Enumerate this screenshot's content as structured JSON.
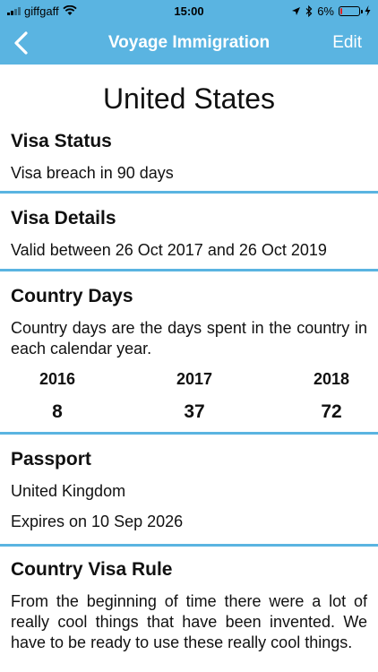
{
  "status_bar": {
    "carrier": "giffgaff",
    "time": "15:00",
    "battery_percent": "6%",
    "battery_level": 0.06
  },
  "nav": {
    "title": "Voyage Immigration",
    "edit_label": "Edit"
  },
  "country": "United States",
  "visa_status": {
    "heading": "Visa Status",
    "text": "Visa breach in 90 days"
  },
  "visa_details": {
    "heading": "Visa Details",
    "text": "Valid between 26 Oct 2017 and 26 Oct 2019"
  },
  "country_days": {
    "heading": "Country Days",
    "description": "Country days are the days spent in the country in each calendar year.",
    "years": [
      {
        "year": "2016",
        "days": "8"
      },
      {
        "year": "2017",
        "days": "37"
      },
      {
        "year": "2018",
        "days": "72"
      }
    ]
  },
  "passport": {
    "heading": "Passport",
    "country": "United Kingdom",
    "expires": "Expires on 10 Sep 2026"
  },
  "visa_rule": {
    "heading": "Country Visa Rule",
    "text": "From the beginning of time there were a lot of really cool things that have been invented. We have to be ready to use these really cool things."
  },
  "colors": {
    "accent": "#5ab4e1",
    "battery_low": "#e02020"
  }
}
